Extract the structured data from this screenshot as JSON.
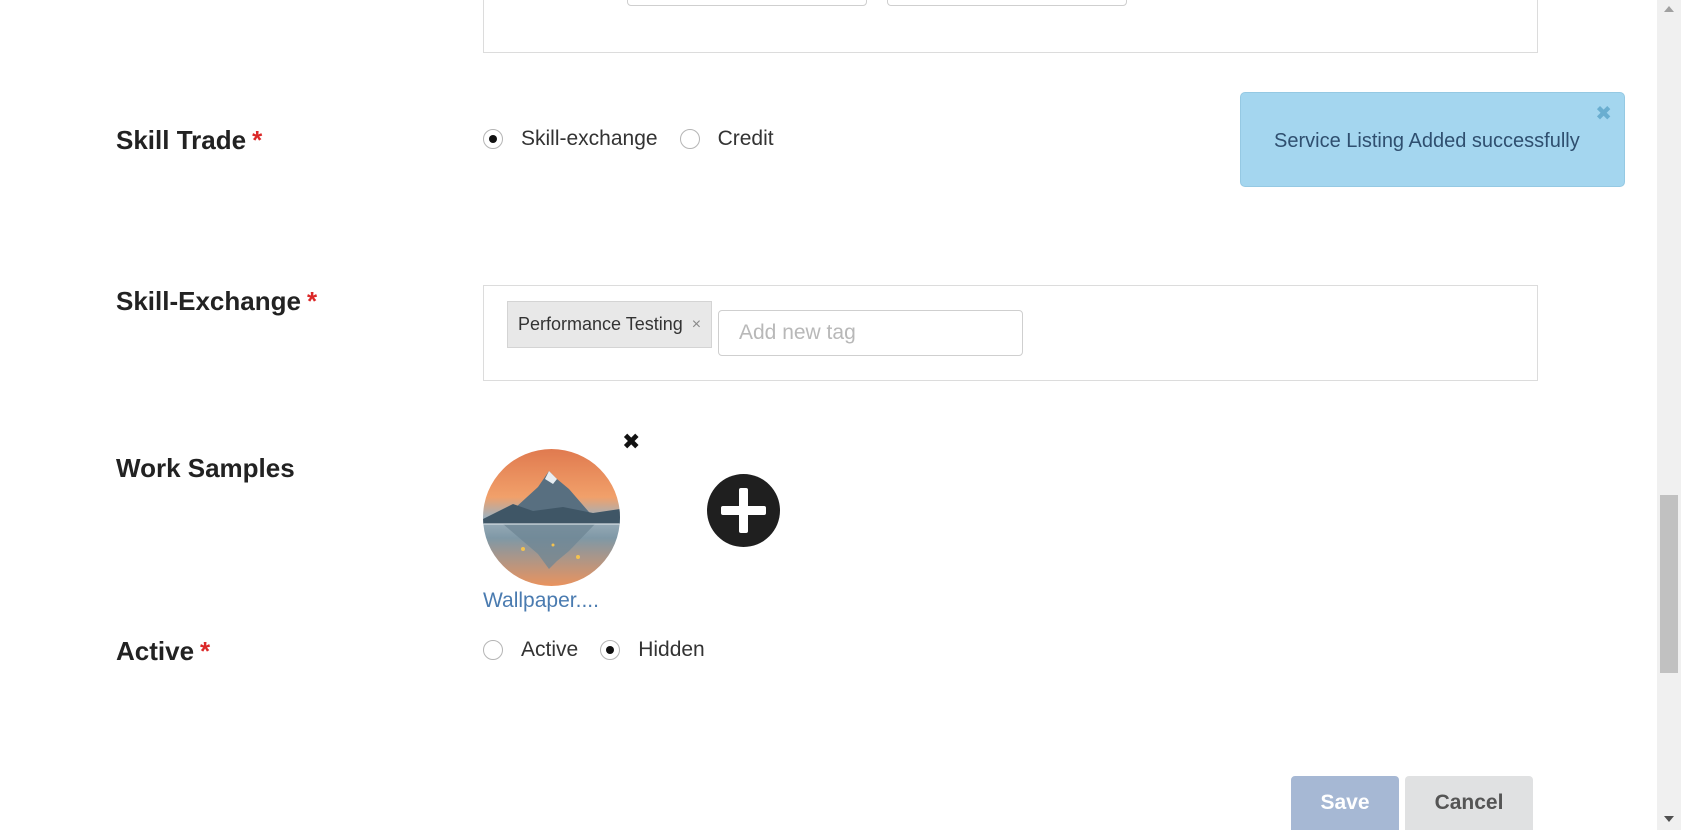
{
  "skill_trade": {
    "label": "Skill Trade",
    "required_mark": "*",
    "options": [
      {
        "label": "Skill-exchange",
        "checked": true
      },
      {
        "label": "Credit",
        "checked": false
      }
    ]
  },
  "skill_exchange": {
    "label": "Skill-Exchange",
    "required_mark": "*",
    "tags": [
      "Performance Testing"
    ],
    "tag_remove": "×",
    "new_tag_placeholder": "Add new tag"
  },
  "work_samples": {
    "label": "Work Samples",
    "file_name": "Wallpaper....",
    "remove_glyph": "✖",
    "add_icon": "plus-circle-icon"
  },
  "active": {
    "label": "Active",
    "required_mark": "*",
    "options": [
      {
        "label": "Active",
        "checked": false
      },
      {
        "label": "Hidden",
        "checked": true
      }
    ]
  },
  "actions": {
    "save_label": "Save",
    "cancel_label": "Cancel"
  },
  "toast": {
    "message": "Service Listing Added successfully",
    "close_glyph": "✖"
  },
  "colors": {
    "required": "#db2828",
    "toast_bg": "#a4d6ef",
    "save_bg": "#a6b8d4",
    "link": "#4a7bb0"
  }
}
